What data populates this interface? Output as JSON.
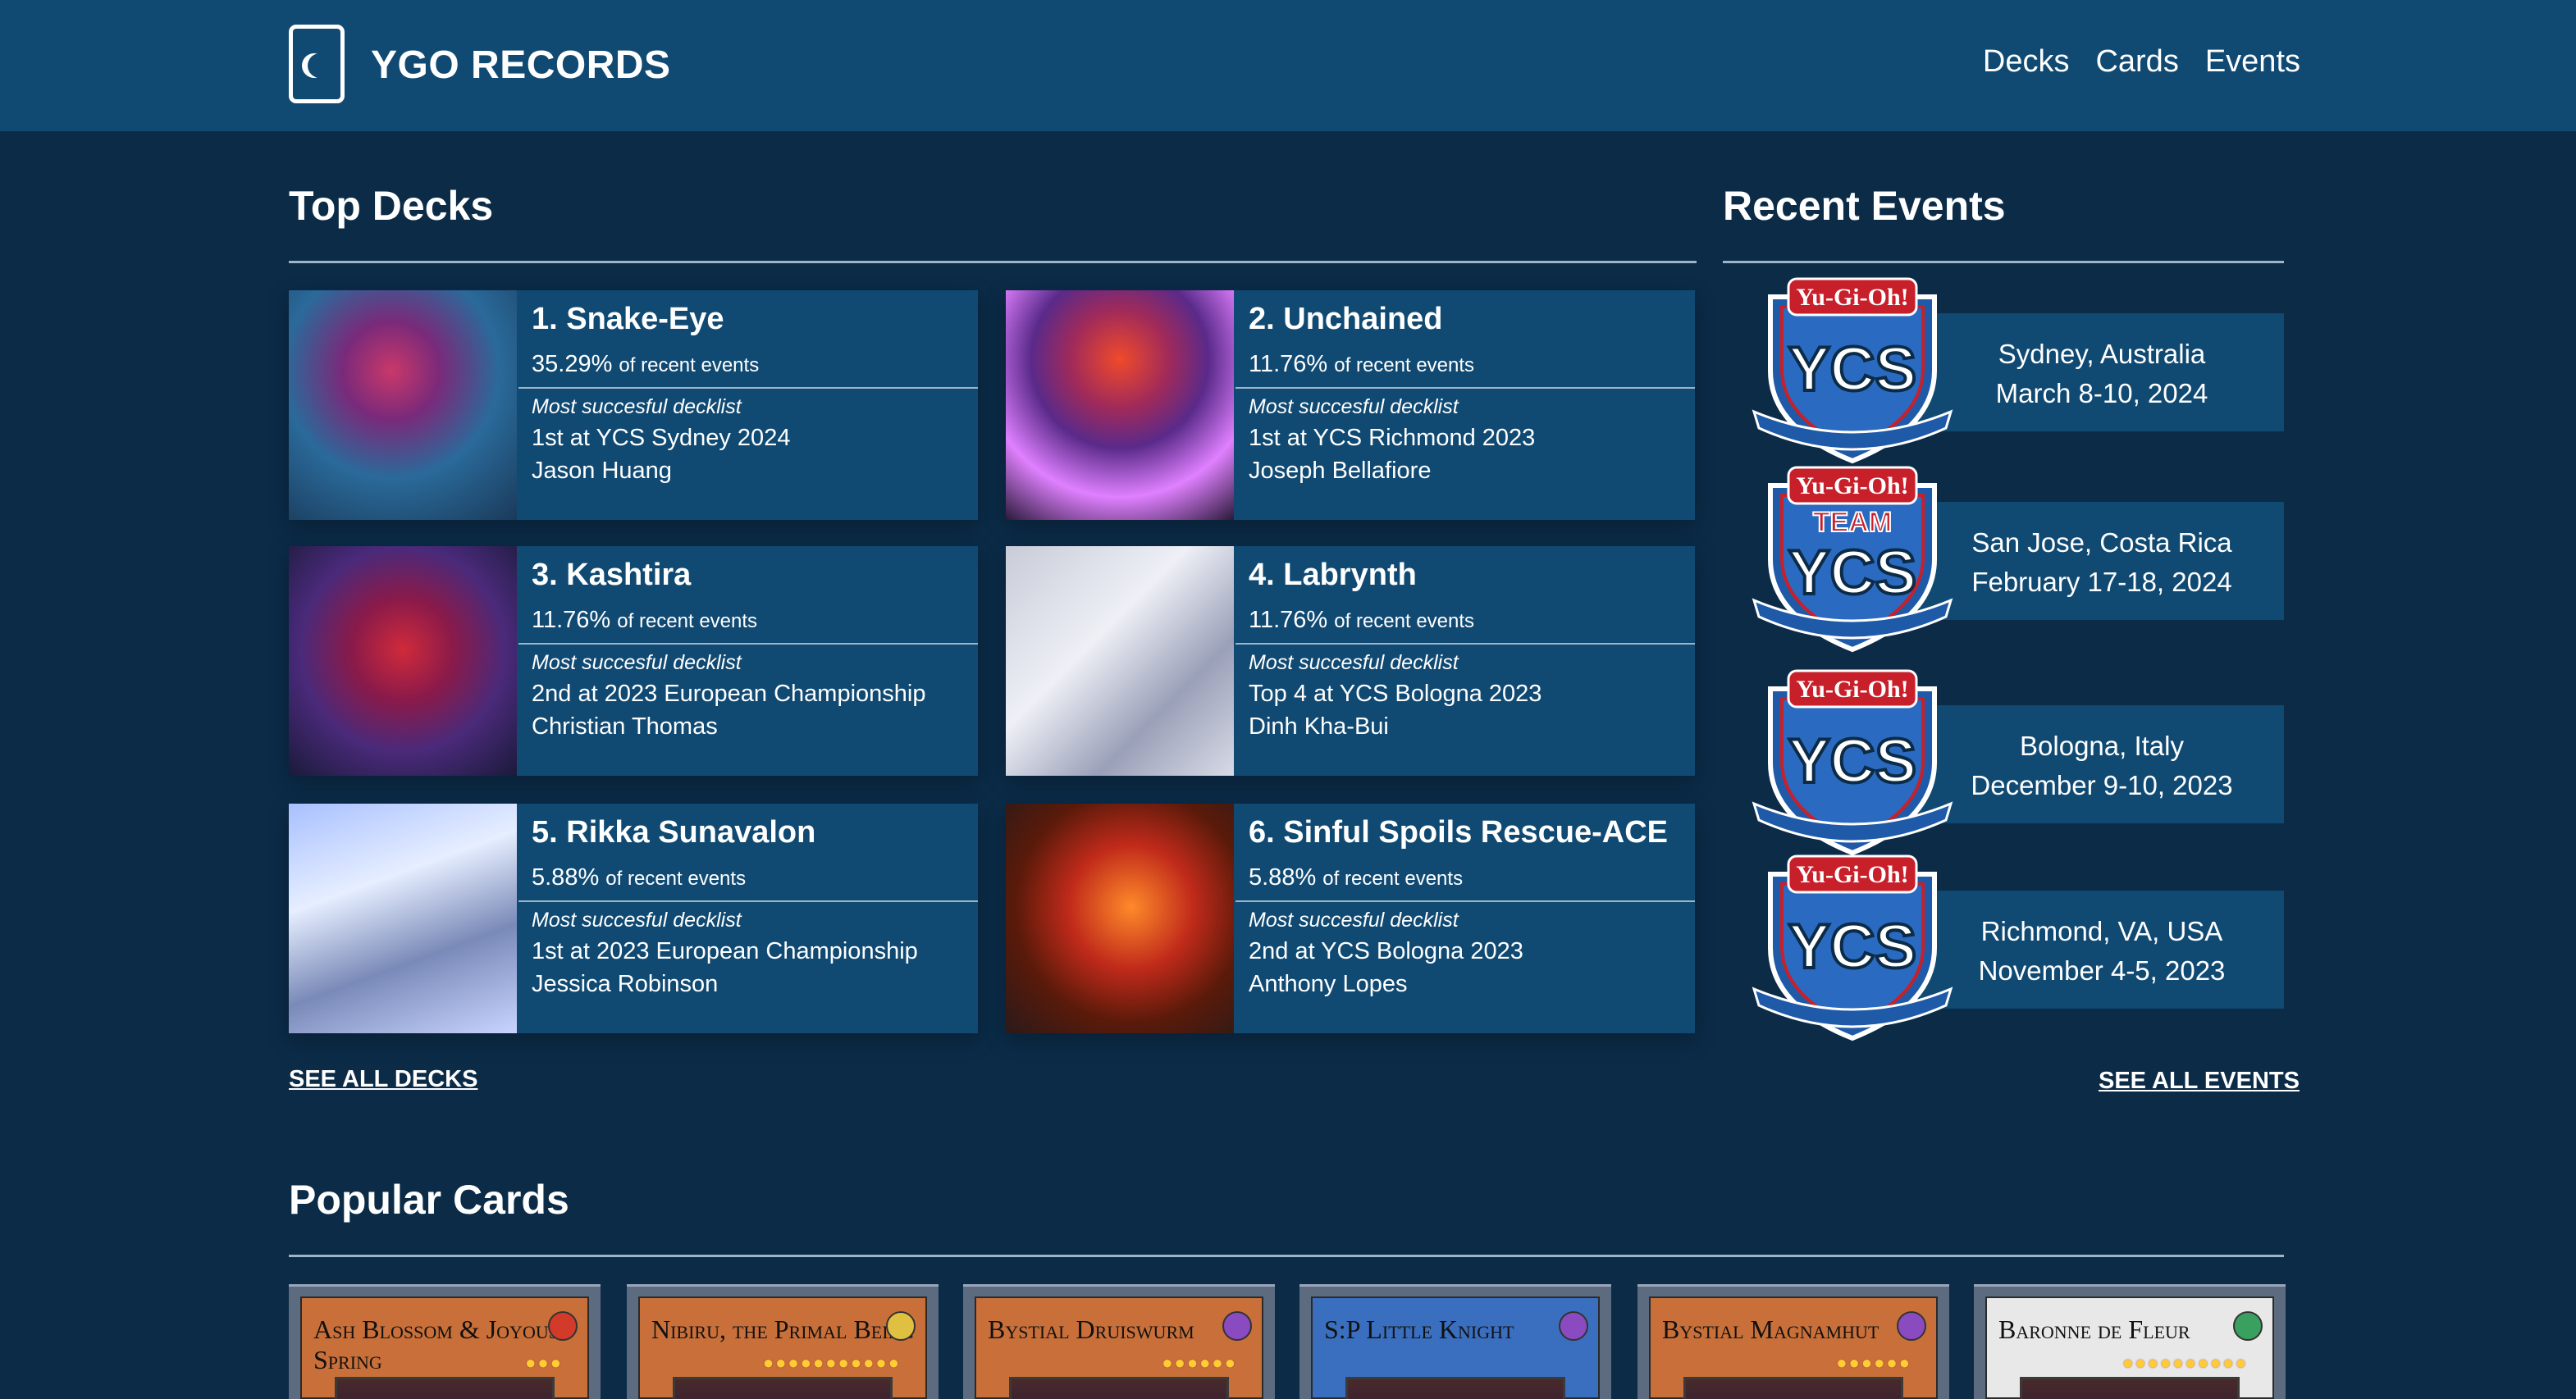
{
  "header": {
    "brand": "YGO RECORDS",
    "nav": [
      "Decks",
      "Cards",
      "Events"
    ]
  },
  "top_decks": {
    "title": "Top Decks",
    "decks": [
      {
        "title": "1. Snake-Eye",
        "pct": "35.29%",
        "pct_suffix": "of recent events",
        "label": "Most succesful decklist",
        "result": "1st at YCS Sydney 2024",
        "player": "Jason Huang"
      },
      {
        "title": "2. Unchained",
        "pct": "11.76%",
        "pct_suffix": "of recent events",
        "label": "Most succesful decklist",
        "result": "1st at YCS Richmond 2023",
        "player": "Joseph Bellafiore"
      },
      {
        "title": "3. Kashtira",
        "pct": "11.76%",
        "pct_suffix": "of recent events",
        "label": "Most succesful decklist",
        "result": "2nd at 2023 European Championship",
        "player": "Christian Thomas"
      },
      {
        "title": "4. Labrynth",
        "pct": "11.76%",
        "pct_suffix": "of recent events",
        "label": "Most succesful decklist",
        "result": "Top 4 at YCS Bologna 2023",
        "player": "Dinh Kha-Bui"
      },
      {
        "title": "5. Rikka Sunavalon",
        "pct": "5.88%",
        "pct_suffix": "of recent events",
        "label": "Most succesful decklist",
        "result": "1st at 2023 European Championship",
        "player": "Jessica Robinson"
      },
      {
        "title": "6. Sinful Spoils Rescue-ACE",
        "pct": "5.88%",
        "pct_suffix": "of recent events",
        "label": "Most succesful decklist",
        "result": "2nd at YCS Bologna 2023",
        "player": "Anthony Lopes"
      }
    ],
    "see_all": "SEE ALL DECKS"
  },
  "recent_events": {
    "title": "Recent Events",
    "events": [
      {
        "location": "Sydney, Australia",
        "date": "March 8-10, 2024",
        "logo_top": "Yu-Gi-Oh!",
        "logo_main": "YCS",
        "logo_team": ""
      },
      {
        "location": "San Jose, Costa Rica",
        "date": "February 17-18, 2024",
        "logo_top": "Yu-Gi-Oh!",
        "logo_main": "YCS",
        "logo_team": "TEAM"
      },
      {
        "location": "Bologna, Italy",
        "date": "December 9-10, 2023",
        "logo_top": "Yu-Gi-Oh!",
        "logo_main": "YCS",
        "logo_team": ""
      },
      {
        "location": "Richmond, VA, USA",
        "date": "November 4-5, 2023",
        "logo_top": "Yu-Gi-Oh!",
        "logo_main": "YCS",
        "logo_team": ""
      }
    ],
    "see_all": "SEE ALL EVENTS"
  },
  "popular_cards": {
    "title": "Popular Cards",
    "cards": [
      {
        "name": "Ash Blossom & Joyous Spring",
        "frame": "#c9703a",
        "attr": "#d23a2a",
        "stars": 3
      },
      {
        "name": "Nibiru, the Primal Being",
        "frame": "#c9703a",
        "attr": "#e0c040",
        "stars": 11
      },
      {
        "name": "Bystial Druiswurm",
        "frame": "#c9703a",
        "attr": "#8a4ac0",
        "stars": 6
      },
      {
        "name": "S:P Little Knight",
        "frame": "#3a6fc0",
        "attr": "#8a4ac0",
        "stars": 0
      },
      {
        "name": "Bystial Magnamhut",
        "frame": "#c9703a",
        "attr": "#8a4ac0",
        "stars": 6
      },
      {
        "name": "Baronne de Fleur",
        "frame": "#e8e8e8",
        "attr": "#3aa060",
        "stars": 10
      }
    ]
  }
}
